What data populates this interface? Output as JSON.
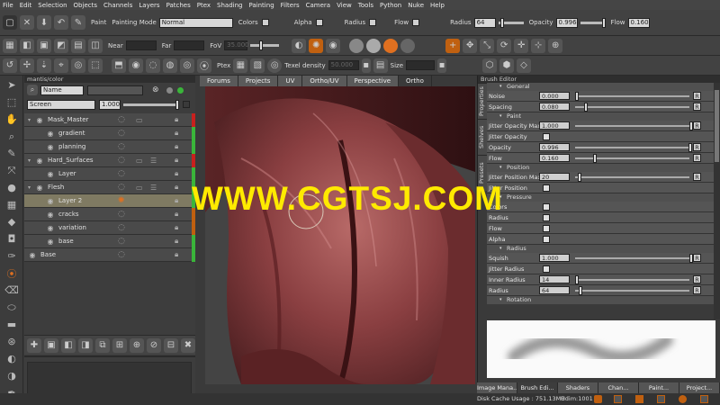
{
  "menu": [
    "File",
    "Edit",
    "Selection",
    "Objects",
    "Channels",
    "Layers",
    "Patches",
    "Ptex",
    "Shading",
    "Painting",
    "Filters",
    "Camera",
    "View",
    "Tools",
    "Python",
    "Nuke",
    "Help"
  ],
  "toolbar1": {
    "paint_label": "Paint",
    "painting_mode_label": "Painting Mode",
    "painting_mode_value": "Normal",
    "colors_label": "Colors",
    "alpha_label": "Alpha",
    "radius_label": "Radius",
    "flow_label": "Flow",
    "radius2_label": "Radius",
    "radius2_value": "64",
    "opacity_label": "Opacity",
    "opacity_value": "0.996",
    "flow2_label": "Flow",
    "flow2_value": "0.160"
  },
  "toolbar2": {
    "near_label": "Near",
    "far_label": "Far",
    "fov_label": "FoV",
    "fov_value": "35.000"
  },
  "toolbar3": {
    "ptex_label": "Ptex",
    "texel_label": "Texel density",
    "texel_value": "50.000",
    "size_label": "Size",
    "size_value": ""
  },
  "layers": {
    "title": "mantis/color",
    "name_filter": "Name",
    "blend_mode": "Screen",
    "opacity": "1.000",
    "items": [
      {
        "name": "Mask_Master",
        "indent": 0,
        "folder": true,
        "stripe": "#c8201e"
      },
      {
        "name": "gradient",
        "indent": 1,
        "folder": false,
        "stripe": "#3ab53a"
      },
      {
        "name": "planning",
        "indent": 1,
        "folder": false,
        "stripe": "#3ab53a"
      },
      {
        "name": "Hard_Surfaces",
        "indent": 0,
        "folder": true,
        "stripe": "#c8201e"
      },
      {
        "name": "Layer",
        "indent": 1,
        "folder": false,
        "stripe": "#3ab53a"
      },
      {
        "name": "Flesh",
        "indent": 0,
        "folder": true,
        "stripe": "#3ab53a"
      },
      {
        "name": "Layer 2",
        "indent": 1,
        "folder": false,
        "stripe": "#3ab53a",
        "selected": true
      },
      {
        "name": "cracks",
        "indent": 1,
        "folder": false,
        "stripe": "#c06010"
      },
      {
        "name": "variation",
        "indent": 1,
        "folder": false,
        "stripe": "#c06010"
      },
      {
        "name": "base",
        "indent": 1,
        "folder": false,
        "stripe": "#3ab53a"
      },
      {
        "name": "Base",
        "indent": 0,
        "folder": false,
        "stripe": "#3ab53a"
      }
    ]
  },
  "viewport_tabs": [
    "Forums",
    "Projects",
    "UV",
    "Ortho/UV",
    "Perspective",
    "Ortho"
  ],
  "active_viewport_tab": "Ortho",
  "brush_editor": {
    "title": "Brush Editor",
    "side_tabs": [
      "Properties",
      "Shelves",
      "Presets"
    ],
    "sections": [
      {
        "title": "General",
        "rows": [
          {
            "label": "Noise",
            "value": "0.000",
            "level": 0.0,
            "slider": true,
            "reset": "R"
          },
          {
            "label": "Spacing",
            "value": "0.080",
            "level": 0.08,
            "slider": true,
            "reset": "R"
          }
        ]
      },
      {
        "title": "Paint",
        "rows": [
          {
            "label": "Jitter Opacity Max",
            "value": "1.000",
            "level": 1.0,
            "slider": true,
            "reset": "R"
          },
          {
            "label": "Jitter Opacity",
            "checkbox": true
          },
          {
            "label": "Opacity",
            "value": "0.996",
            "level": 0.996,
            "slider": true,
            "reset": "R"
          },
          {
            "label": "Flow",
            "value": "0.160",
            "level": 0.16,
            "slider": true,
            "reset": "R"
          }
        ]
      },
      {
        "title": "Position",
        "rows": [
          {
            "label": "Jitter Position Max",
            "value": "20",
            "level": 0.02,
            "slider": true,
            "reset": "R"
          },
          {
            "label": "Jitter Position",
            "checkbox": true
          }
        ]
      },
      {
        "title": "Pressure",
        "rows": [
          {
            "label": "Colors",
            "checkbox": true
          },
          {
            "label": "Radius",
            "checkbox": true
          },
          {
            "label": "Flow",
            "checkbox": true
          },
          {
            "label": "Alpha",
            "checkbox": true
          }
        ]
      },
      {
        "title": "Radius",
        "rows": [
          {
            "label": "Squish",
            "value": "1.000",
            "level": 1.0,
            "slider": true,
            "reset": "R"
          },
          {
            "label": "Jitter Radius",
            "checkbox": true
          },
          {
            "label": "Inner Radius",
            "value": "14",
            "level": 0.0,
            "slider": true,
            "reset": "R"
          },
          {
            "label": "Radius",
            "value": "64",
            "level": 0.03,
            "slider": true,
            "reset": "R"
          }
        ]
      },
      {
        "title": "Rotation",
        "rows": []
      }
    ]
  },
  "bottom_tabs": [
    "Image Mana...",
    "Brush Edi...",
    "Shaders",
    "Chan...",
    "Paint...",
    "Project..."
  ],
  "active_bottom_tab": "Brush Edi...",
  "status": {
    "cache": "Disk Cache Usage : 751.13MB",
    "udim": "Udim:1001"
  },
  "watermark": "WWW.CGTSJ.COM",
  "colors": {
    "accent_orange": "#e07020",
    "stripe_red": "#c8201e",
    "stripe_green": "#3ab53a",
    "watermark": "#ffea00"
  }
}
